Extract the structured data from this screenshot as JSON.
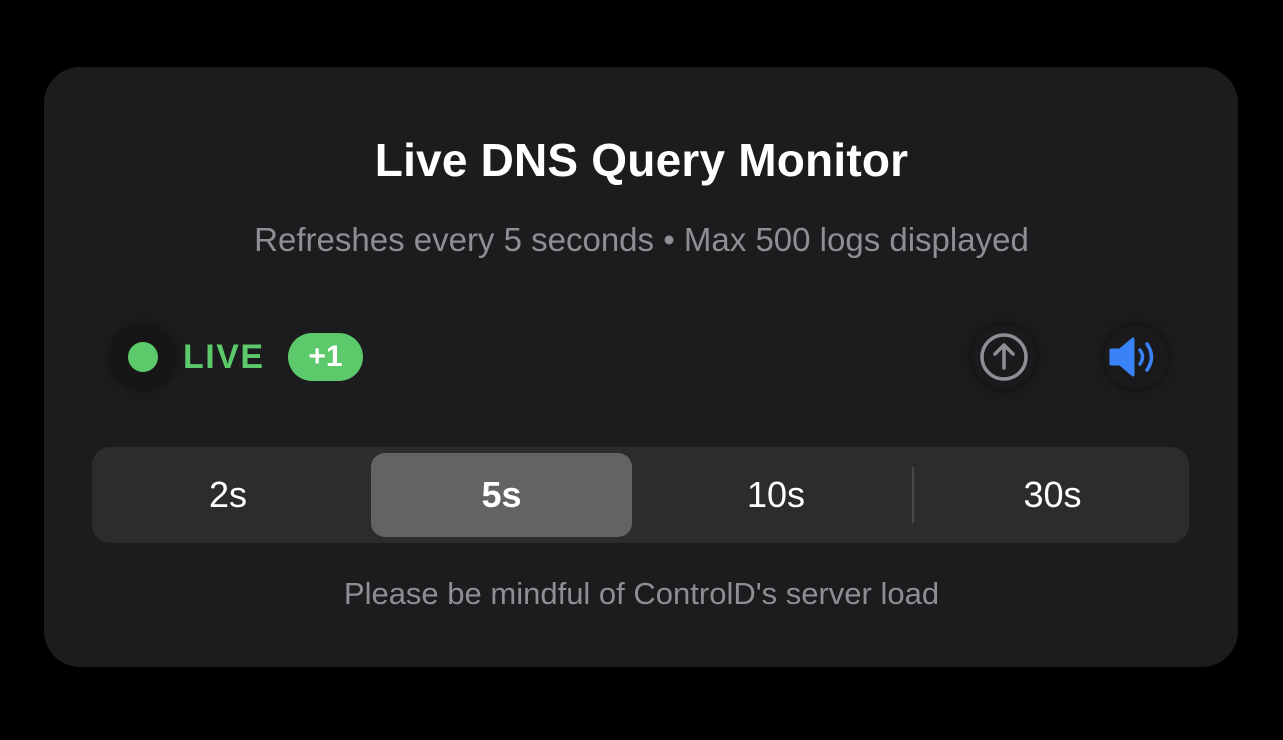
{
  "header": {
    "title": "Live DNS Query Monitor",
    "subtitle": "Refreshes every 5 seconds • Max 500 logs displayed"
  },
  "status": {
    "live_label": "LIVE",
    "new_count": "+1",
    "live_color": "#5cc96a",
    "live_icon": "live-dot-icon"
  },
  "actions": {
    "scroll_top_icon": "arrow-up-circle-icon",
    "sound_icon": "speaker-wave-icon",
    "sound_color": "#3a82f7"
  },
  "refresh_intervals": {
    "options": [
      "2s",
      "5s",
      "10s",
      "30s"
    ],
    "selected": "5s"
  },
  "footer": {
    "note": "Please be mindful of ControlD's server load"
  }
}
